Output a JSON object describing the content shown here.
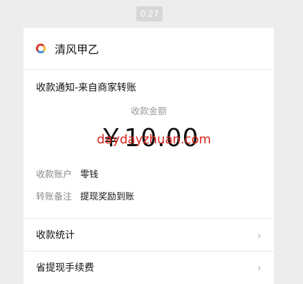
{
  "timestamp": "0:27",
  "app": {
    "name": "清风甲乙"
  },
  "notice": {
    "title": "收款通知-来自商家转账"
  },
  "amount": {
    "label": "收款金额",
    "value": "￥10.00"
  },
  "watermark": "daydayzhuan.com",
  "details": [
    {
      "label": "收款账户",
      "value": "零钱"
    },
    {
      "label": "转账备注",
      "value": "提现奖励到账"
    }
  ],
  "links": [
    {
      "label": "收款统计"
    },
    {
      "label": "省提现手续费"
    }
  ]
}
